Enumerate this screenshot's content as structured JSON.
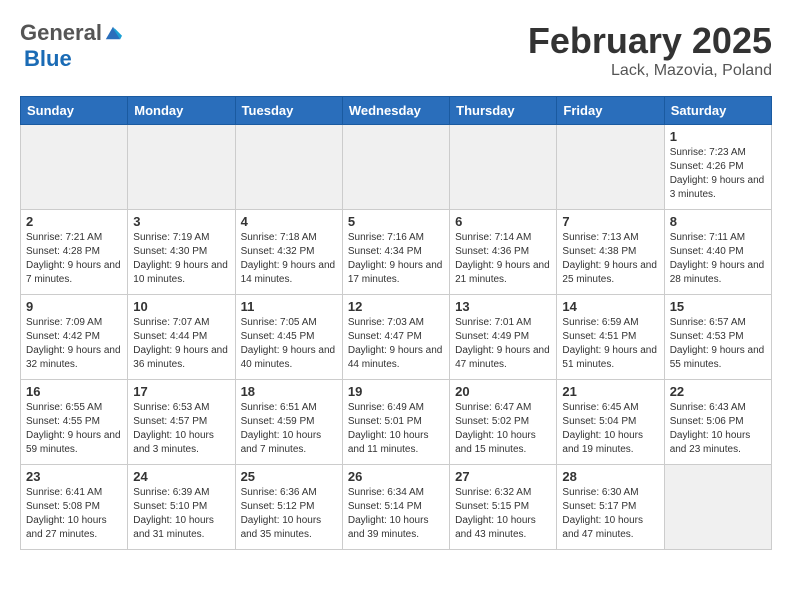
{
  "header": {
    "logo_general": "General",
    "logo_blue": "Blue",
    "month_title": "February 2025",
    "location": "Lack, Mazovia, Poland"
  },
  "calendar": {
    "days_of_week": [
      "Sunday",
      "Monday",
      "Tuesday",
      "Wednesday",
      "Thursday",
      "Friday",
      "Saturday"
    ],
    "weeks": [
      [
        {
          "day": "",
          "empty": true
        },
        {
          "day": "",
          "empty": true
        },
        {
          "day": "",
          "empty": true
        },
        {
          "day": "",
          "empty": true
        },
        {
          "day": "",
          "empty": true
        },
        {
          "day": "",
          "empty": true
        },
        {
          "day": "1",
          "sunrise": "Sunrise: 7:23 AM",
          "sunset": "Sunset: 4:26 PM",
          "daylight": "Daylight: 9 hours and 3 minutes."
        }
      ],
      [
        {
          "day": "2",
          "sunrise": "Sunrise: 7:21 AM",
          "sunset": "Sunset: 4:28 PM",
          "daylight": "Daylight: 9 hours and 7 minutes."
        },
        {
          "day": "3",
          "sunrise": "Sunrise: 7:19 AM",
          "sunset": "Sunset: 4:30 PM",
          "daylight": "Daylight: 9 hours and 10 minutes."
        },
        {
          "day": "4",
          "sunrise": "Sunrise: 7:18 AM",
          "sunset": "Sunset: 4:32 PM",
          "daylight": "Daylight: 9 hours and 14 minutes."
        },
        {
          "day": "5",
          "sunrise": "Sunrise: 7:16 AM",
          "sunset": "Sunset: 4:34 PM",
          "daylight": "Daylight: 9 hours and 17 minutes."
        },
        {
          "day": "6",
          "sunrise": "Sunrise: 7:14 AM",
          "sunset": "Sunset: 4:36 PM",
          "daylight": "Daylight: 9 hours and 21 minutes."
        },
        {
          "day": "7",
          "sunrise": "Sunrise: 7:13 AM",
          "sunset": "Sunset: 4:38 PM",
          "daylight": "Daylight: 9 hours and 25 minutes."
        },
        {
          "day": "8",
          "sunrise": "Sunrise: 7:11 AM",
          "sunset": "Sunset: 4:40 PM",
          "daylight": "Daylight: 9 hours and 28 minutes."
        }
      ],
      [
        {
          "day": "9",
          "sunrise": "Sunrise: 7:09 AM",
          "sunset": "Sunset: 4:42 PM",
          "daylight": "Daylight: 9 hours and 32 minutes."
        },
        {
          "day": "10",
          "sunrise": "Sunrise: 7:07 AM",
          "sunset": "Sunset: 4:44 PM",
          "daylight": "Daylight: 9 hours and 36 minutes."
        },
        {
          "day": "11",
          "sunrise": "Sunrise: 7:05 AM",
          "sunset": "Sunset: 4:45 PM",
          "daylight": "Daylight: 9 hours and 40 minutes."
        },
        {
          "day": "12",
          "sunrise": "Sunrise: 7:03 AM",
          "sunset": "Sunset: 4:47 PM",
          "daylight": "Daylight: 9 hours and 44 minutes."
        },
        {
          "day": "13",
          "sunrise": "Sunrise: 7:01 AM",
          "sunset": "Sunset: 4:49 PM",
          "daylight": "Daylight: 9 hours and 47 minutes."
        },
        {
          "day": "14",
          "sunrise": "Sunrise: 6:59 AM",
          "sunset": "Sunset: 4:51 PM",
          "daylight": "Daylight: 9 hours and 51 minutes."
        },
        {
          "day": "15",
          "sunrise": "Sunrise: 6:57 AM",
          "sunset": "Sunset: 4:53 PM",
          "daylight": "Daylight: 9 hours and 55 minutes."
        }
      ],
      [
        {
          "day": "16",
          "sunrise": "Sunrise: 6:55 AM",
          "sunset": "Sunset: 4:55 PM",
          "daylight": "Daylight: 9 hours and 59 minutes."
        },
        {
          "day": "17",
          "sunrise": "Sunrise: 6:53 AM",
          "sunset": "Sunset: 4:57 PM",
          "daylight": "Daylight: 10 hours and 3 minutes."
        },
        {
          "day": "18",
          "sunrise": "Sunrise: 6:51 AM",
          "sunset": "Sunset: 4:59 PM",
          "daylight": "Daylight: 10 hours and 7 minutes."
        },
        {
          "day": "19",
          "sunrise": "Sunrise: 6:49 AM",
          "sunset": "Sunset: 5:01 PM",
          "daylight": "Daylight: 10 hours and 11 minutes."
        },
        {
          "day": "20",
          "sunrise": "Sunrise: 6:47 AM",
          "sunset": "Sunset: 5:02 PM",
          "daylight": "Daylight: 10 hours and 15 minutes."
        },
        {
          "day": "21",
          "sunrise": "Sunrise: 6:45 AM",
          "sunset": "Sunset: 5:04 PM",
          "daylight": "Daylight: 10 hours and 19 minutes."
        },
        {
          "day": "22",
          "sunrise": "Sunrise: 6:43 AM",
          "sunset": "Sunset: 5:06 PM",
          "daylight": "Daylight: 10 hours and 23 minutes."
        }
      ],
      [
        {
          "day": "23",
          "sunrise": "Sunrise: 6:41 AM",
          "sunset": "Sunset: 5:08 PM",
          "daylight": "Daylight: 10 hours and 27 minutes."
        },
        {
          "day": "24",
          "sunrise": "Sunrise: 6:39 AM",
          "sunset": "Sunset: 5:10 PM",
          "daylight": "Daylight: 10 hours and 31 minutes."
        },
        {
          "day": "25",
          "sunrise": "Sunrise: 6:36 AM",
          "sunset": "Sunset: 5:12 PM",
          "daylight": "Daylight: 10 hours and 35 minutes."
        },
        {
          "day": "26",
          "sunrise": "Sunrise: 6:34 AM",
          "sunset": "Sunset: 5:14 PM",
          "daylight": "Daylight: 10 hours and 39 minutes."
        },
        {
          "day": "27",
          "sunrise": "Sunrise: 6:32 AM",
          "sunset": "Sunset: 5:15 PM",
          "daylight": "Daylight: 10 hours and 43 minutes."
        },
        {
          "day": "28",
          "sunrise": "Sunrise: 6:30 AM",
          "sunset": "Sunset: 5:17 PM",
          "daylight": "Daylight: 10 hours and 47 minutes."
        },
        {
          "day": "",
          "empty": true
        }
      ]
    ]
  }
}
